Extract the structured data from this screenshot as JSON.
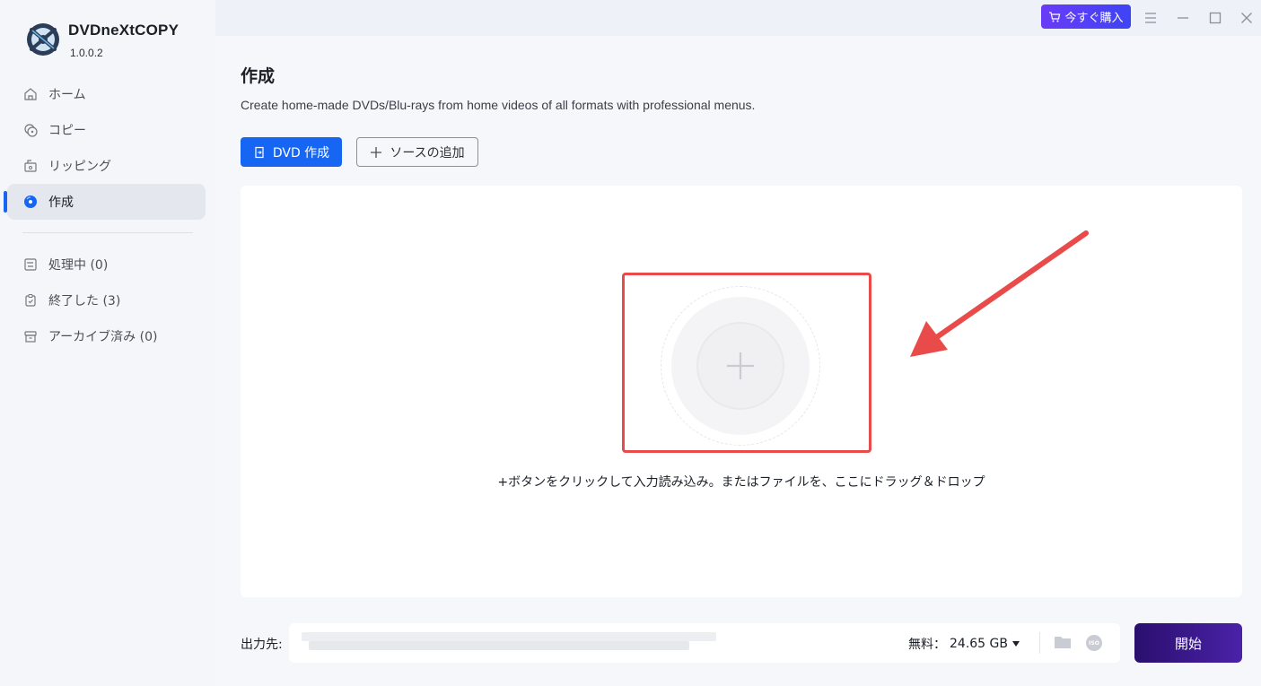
{
  "app": {
    "name": "DVDneXtCOPY",
    "version": "1.0.0.2"
  },
  "nav": {
    "items": [
      {
        "label": "ホーム",
        "icon": "home-icon"
      },
      {
        "label": "コピー",
        "icon": "copy-disc-icon"
      },
      {
        "label": "リッピング",
        "icon": "ripping-icon"
      },
      {
        "label": "作成",
        "icon": "create-disc-icon",
        "active": true
      }
    ],
    "status_items": [
      {
        "label": "処理中 (0)",
        "icon": "processing-list-icon"
      },
      {
        "label": "終了した (3)",
        "icon": "finished-clipboard-icon"
      },
      {
        "label": "アーカイブ済み (0)",
        "icon": "archive-box-icon"
      }
    ]
  },
  "titlebar": {
    "buy_label": "今すぐ購入"
  },
  "main": {
    "title": "作成",
    "description": "Create home-made DVDs/Blu-rays from home videos of all formats with professional menus.",
    "dvd_create_label": "DVD 作成",
    "add_source_label": "ソースの追加",
    "drop_hint": "+ボタンをクリックして入力読み込み。またはファイルを、ここにドラッグ＆ドロップ"
  },
  "footer": {
    "output_label": "出力先:",
    "free_label": "無料：",
    "free_value": "24.65 GB",
    "start_label": "開始"
  },
  "colors": {
    "accent": "#1766f3",
    "buy_gradient": "#6a3bf7",
    "start_gradient": "#2a0f6e",
    "highlight_red": "#e94b4b"
  }
}
